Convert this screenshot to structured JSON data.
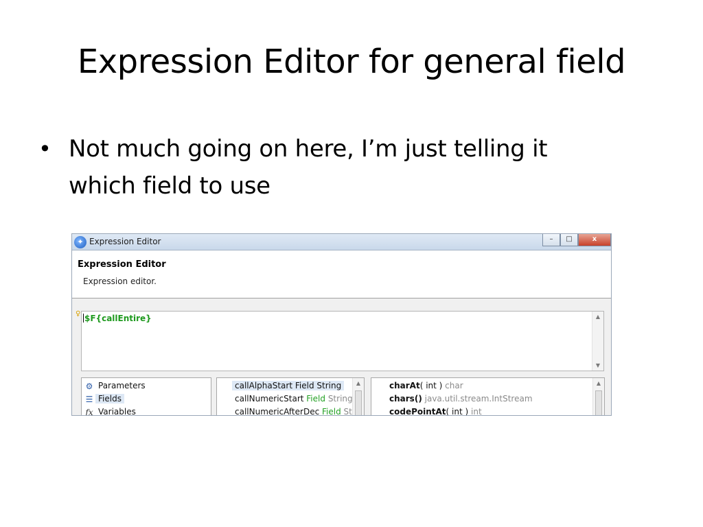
{
  "slide": {
    "title": "Expression Editor for general field",
    "bullets": [
      "Not much going on here, I’m just telling it which field to use"
    ]
  },
  "window": {
    "title": "Expression Editor",
    "header_title": "Expression Editor",
    "header_desc": "Expression editor.",
    "expression": "$F{callEntire}",
    "categories": [
      {
        "label": "Parameters",
        "icon": "parameters-icon"
      },
      {
        "label": "Fields",
        "icon": "fields-icon"
      },
      {
        "label": "Variables",
        "icon": "variables-icon",
        "glyph": "fx"
      }
    ],
    "fields": [
      {
        "name": "callAlphaStart",
        "kind": "Field",
        "type": "String"
      },
      {
        "name": "callNumericStart",
        "kind": "Field",
        "type": "String"
      },
      {
        "name": "callNumericAfterDec",
        "kind": "Field",
        "type": "Stri"
      }
    ],
    "methods": [
      {
        "name": "charAt",
        "args": "( int )",
        "ret": "char"
      },
      {
        "name": "chars",
        "args": "()",
        "ret": "java.util.stream.IntStream"
      },
      {
        "name": "codePointAt",
        "args": "( int )",
        "ret": "int"
      }
    ],
    "win_buttons": {
      "min": "–",
      "max": "□",
      "close": "x"
    }
  }
}
